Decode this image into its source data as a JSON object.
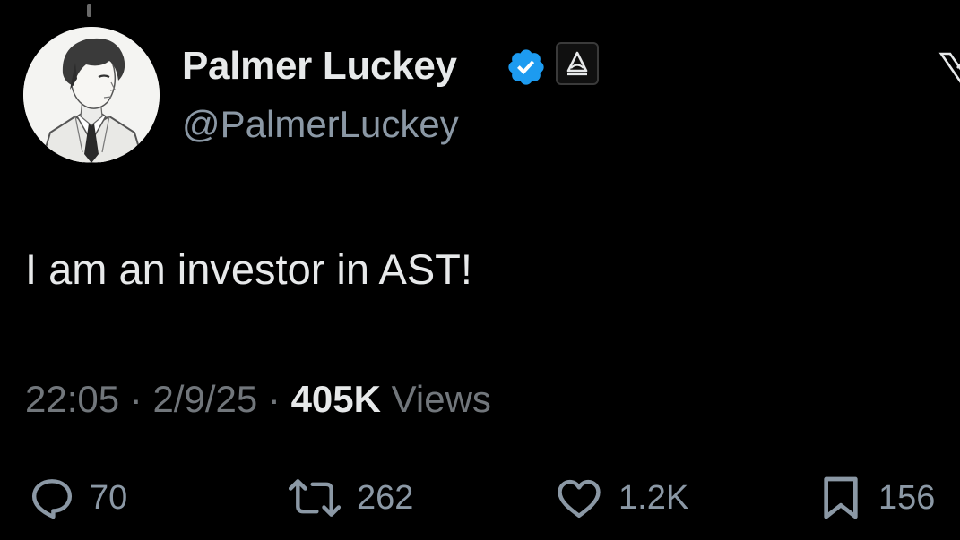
{
  "tweet": {
    "author": {
      "display_name": "Palmer Luckey",
      "handle": "@PalmerLuckey",
      "verified": true,
      "verified_color": "#1d9bf0",
      "affiliate_badge_icon": "affiliate-logo-icon",
      "avatar": "anime-portrait-avatar"
    },
    "text": "I am an investor in AST!",
    "meta": {
      "time": "22:05",
      "separator": "·",
      "date": "2/9/25",
      "views_count": "405K",
      "views_label": "Views"
    },
    "actions": {
      "replies": "70",
      "reposts": "262",
      "likes": "1.2K",
      "bookmarks": "156"
    }
  },
  "colors": {
    "background": "#000000",
    "primary_text": "#e7e9ea",
    "secondary_text": "#71767b",
    "icon_gray": "#8b98a5",
    "verified_blue": "#1d9bf0"
  }
}
